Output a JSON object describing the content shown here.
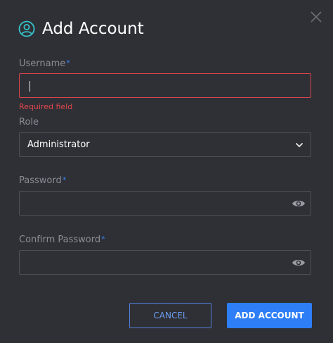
{
  "dialog": {
    "title": "Add Account",
    "title_icon": "user-circle-icon",
    "close_icon": "close-icon"
  },
  "fields": {
    "username": {
      "label": "Username",
      "required_mark": "*",
      "value": "",
      "error": "Required field"
    },
    "role": {
      "label": "Role",
      "value": "Administrator",
      "icon": "chevron-down-icon"
    },
    "password": {
      "label": "Password",
      "required_mark": "*",
      "value": "",
      "icon": "eye-icon"
    },
    "confirm_password": {
      "label": "Confirm Password",
      "required_mark": "*",
      "value": "",
      "icon": "eye-icon"
    }
  },
  "actions": {
    "cancel_label": "CANCEL",
    "submit_label": "ADD ACCOUNT"
  },
  "colors": {
    "background": "#2f3036",
    "accent": "#2d7ef7",
    "error": "#d9464a",
    "required_mark": "#3b82f6"
  }
}
